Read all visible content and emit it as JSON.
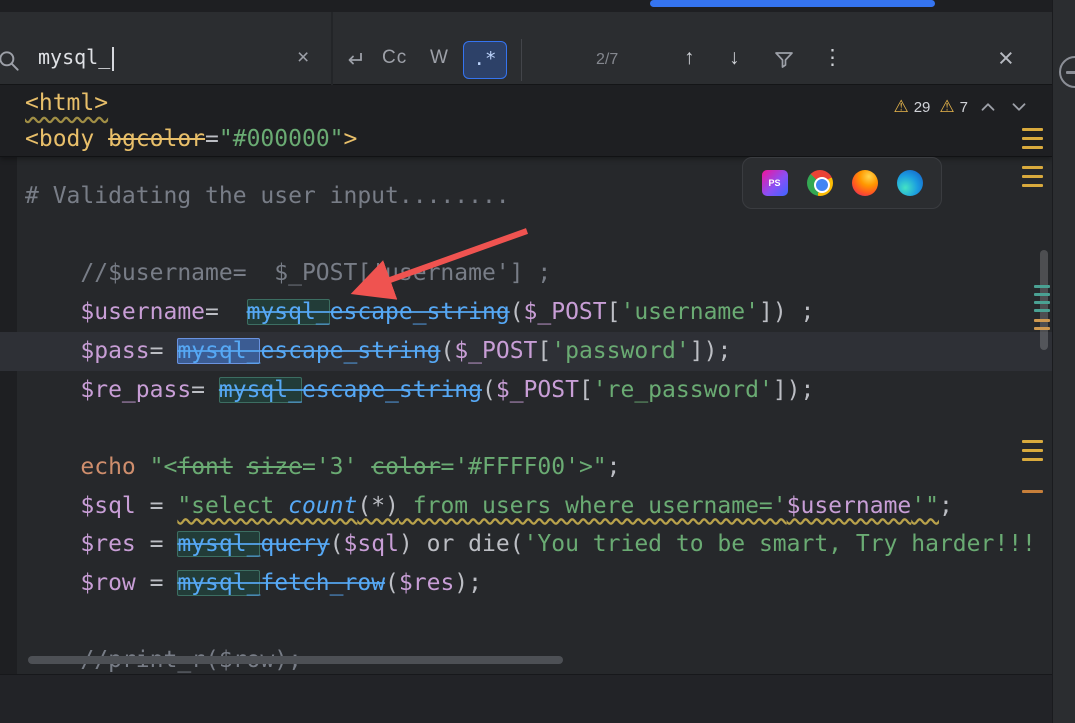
{
  "search_bar": {
    "query": "mysql_",
    "clear_label": "×",
    "match_case_label": "Cc",
    "words_label": "W",
    "regex_label": ".*",
    "match_counter": "2/7",
    "prev_label": "↑",
    "next_label": "↓",
    "more_label": "⋮",
    "close_label": "×"
  },
  "editor": {
    "inspections": {
      "error_icon": "⚠",
      "error_count": "29",
      "warning_icon": "⚠",
      "warning_count": "7"
    },
    "sticky_lines": [
      {
        "tokens": [
          [
            "tag wavy-tag",
            "<html>"
          ]
        ]
      },
      {
        "tokens": [
          [
            "tag",
            "<body "
          ],
          [
            "tag strike",
            "bgcolor"
          ],
          [
            "pun",
            "="
          ],
          [
            "str",
            "\"#000000\""
          ],
          [
            "tag",
            ">"
          ]
        ]
      }
    ],
    "lines": [
      {
        "tokens": [
          [
            "cmt",
            "# Validating the user input........"
          ]
        ]
      },
      {
        "tokens": []
      },
      {
        "tokens": [
          [
            "cmt",
            "    //$username=  $_POST['username'] ;"
          ]
        ]
      },
      {
        "tokens": [
          [
            "pun",
            "    "
          ],
          [
            "v",
            "$username"
          ],
          [
            "pun",
            "=  "
          ],
          [
            "fn match",
            "mysql_"
          ],
          [
            "fn",
            "escape_string"
          ],
          [
            "pun",
            "("
          ],
          [
            "v",
            "$_POST"
          ],
          [
            "pun",
            "["
          ],
          [
            "str",
            "'username'"
          ],
          [
            "pun",
            "]) ;"
          ]
        ]
      },
      {
        "current": true,
        "tokens": [
          [
            "pun",
            "    "
          ],
          [
            "v",
            "$pass"
          ],
          [
            "pun",
            "= "
          ],
          [
            "fn sel",
            "mysql_"
          ],
          [
            "fn",
            "escape_string"
          ],
          [
            "pun",
            "("
          ],
          [
            "v",
            "$_POST"
          ],
          [
            "pun",
            "["
          ],
          [
            "str",
            "'password'"
          ],
          [
            "pun",
            "]);"
          ]
        ]
      },
      {
        "tokens": [
          [
            "pun",
            "    "
          ],
          [
            "v",
            "$re_pass"
          ],
          [
            "pun",
            "= "
          ],
          [
            "fn match",
            "mysql_"
          ],
          [
            "fn",
            "escape_string"
          ],
          [
            "pun",
            "("
          ],
          [
            "v",
            "$_POST"
          ],
          [
            "pun",
            "["
          ],
          [
            "str",
            "'re_password'"
          ],
          [
            "pun",
            "]);"
          ]
        ]
      },
      {
        "tokens": []
      },
      {
        "tokens": [
          [
            "pun",
            "    "
          ],
          [
            "kw",
            "echo"
          ],
          [
            "pun",
            " "
          ],
          [
            "str",
            "\"<"
          ],
          [
            "str strike",
            "font"
          ],
          [
            "str",
            " "
          ],
          [
            "str strike",
            "size"
          ],
          [
            "str",
            "='3' "
          ],
          [
            "str strike",
            "color"
          ],
          [
            "str",
            "='#FFFF00'>\""
          ],
          [
            "pun",
            ";"
          ]
        ]
      },
      {
        "tokens": [
          [
            "pun",
            "    "
          ],
          [
            "v",
            "$sql"
          ],
          [
            "pun",
            " = "
          ],
          [
            "str wavy",
            "\"select "
          ],
          [
            "sqlfn wavy",
            "count"
          ],
          [
            "pun wavy",
            "(*)"
          ],
          [
            "str wavy",
            " from users where username='"
          ],
          [
            "v wavy",
            "$username"
          ],
          [
            "str wavy",
            "'\""
          ],
          [
            "pun",
            ";"
          ]
        ]
      },
      {
        "tokens": [
          [
            "pun",
            "    "
          ],
          [
            "v",
            "$res"
          ],
          [
            "pun",
            " = "
          ],
          [
            "fn match",
            "mysql_"
          ],
          [
            "fn",
            "query"
          ],
          [
            "pun",
            "("
          ],
          [
            "v",
            "$sql"
          ],
          [
            "pun",
            ") or die("
          ],
          [
            "str",
            "'You tried to be smart, Try harder!!!"
          ]
        ]
      },
      {
        "tokens": [
          [
            "pun",
            "    "
          ],
          [
            "v",
            "$row"
          ],
          [
            "pun",
            " = "
          ],
          [
            "fn match",
            "mysql_"
          ],
          [
            "fn",
            "fetch_row"
          ],
          [
            "pun",
            "("
          ],
          [
            "v",
            "$res"
          ],
          [
            "pun",
            ");"
          ]
        ]
      },
      {
        "tokens": []
      },
      {
        "tokens": [
          [
            "cmt",
            "    //print_r($row);"
          ]
        ]
      }
    ]
  },
  "browser_toolbar": {
    "phpstorm_label": "PS",
    "icons": [
      "phpstorm",
      "chrome",
      "firefox",
      "edge"
    ]
  },
  "annotation": {
    "type": "arrow",
    "color": "#ef5350"
  },
  "colors": {
    "accent": "#3574f0",
    "selection": "#3b5c93",
    "match_highlight": "#3c6e62",
    "warning": "#e8b64c",
    "deprecated_function": "#56a8f5",
    "string": "#6aab73",
    "variable": "#c89ed6"
  }
}
